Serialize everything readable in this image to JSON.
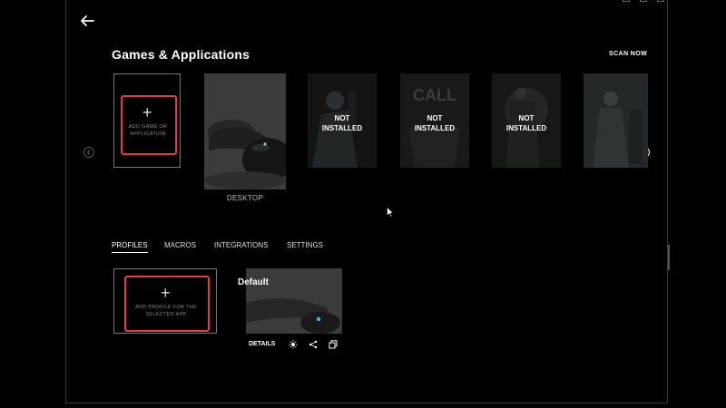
{
  "header": {
    "title": "Games & Applications",
    "scan_now": "SCAN NOW"
  },
  "icons": {
    "back": "arrow-left",
    "carousel_prev": "chevron-left-circle",
    "carousel_next": "chevron-right-circle",
    "add": "plus",
    "lighting": "lighting-sun",
    "share": "share",
    "copy": "copy"
  },
  "carousel": {
    "add_game": {
      "plus": "+",
      "label_line1": "ADD GAME OR",
      "label_line2": "APPLICATION"
    },
    "desktop_label": "DESKTOP",
    "games": [
      {
        "status_line1": "NOT",
        "status_line2": "INSTALLED"
      },
      {
        "status_line1": "NOT",
        "status_line2": "INSTALLED"
      },
      {
        "status_line1": "NOT",
        "status_line2": "INSTALLED"
      }
    ]
  },
  "tabs": [
    {
      "label": "PROFILES",
      "active": true
    },
    {
      "label": "MACROS",
      "active": false
    },
    {
      "label": "INTEGRATIONS",
      "active": false
    },
    {
      "label": "SETTINGS",
      "active": false
    }
  ],
  "profiles": {
    "add_profile": {
      "plus": "+",
      "label_line1": "ADD PROFILE FOR THE",
      "label_line2": "SELECTED APP"
    },
    "default": {
      "name": "Default",
      "details": "DETAILS"
    }
  },
  "colors": {
    "background": "#000000",
    "highlight_red": "#e63b3b",
    "text": "#ffffff"
  }
}
